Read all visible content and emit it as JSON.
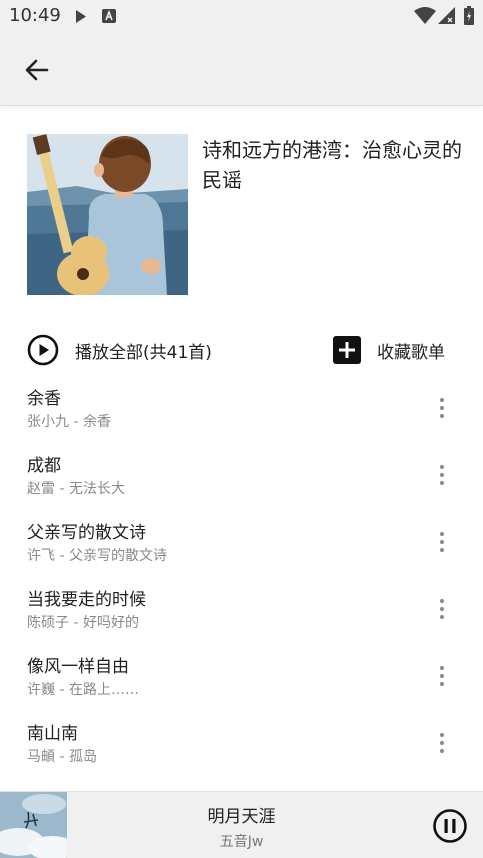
{
  "status_bar": {
    "time": "10:49",
    "icons": [
      "play-icon",
      "a-box-icon",
      "wifi-icon",
      "signal-icon",
      "battery-charging-icon"
    ]
  },
  "app_bar": {
    "back_icon": "arrow-left-icon"
  },
  "playlist": {
    "title": "诗和远方的港湾：治愈心灵的民谣",
    "cover_icon": "guitar-boy-cover"
  },
  "actions": {
    "play_all_label": "播放全部(共41首)",
    "collect_label": "收藏歌单"
  },
  "songs": [
    {
      "name": "余香",
      "subtitle": "张小九 - 余香"
    },
    {
      "name": "成都",
      "subtitle": "赵雷 - 无法长大"
    },
    {
      "name": "父亲写的散文诗",
      "subtitle": "许飞 - 父亲写的散文诗"
    },
    {
      "name": "当我要走的时候",
      "subtitle": "陈硕子 - 好吗好的"
    },
    {
      "name": "像风一样自由",
      "subtitle": "许巍 - 在路上……"
    },
    {
      "name": "南山南",
      "subtitle": "马頔 - 孤岛"
    }
  ],
  "now_playing": {
    "title": "明月天涯",
    "artist": "五音Jw"
  },
  "colors": {
    "bar_background": "#f0f0f0",
    "text_primary": "#212121",
    "text_secondary": "#8a8a8a"
  }
}
